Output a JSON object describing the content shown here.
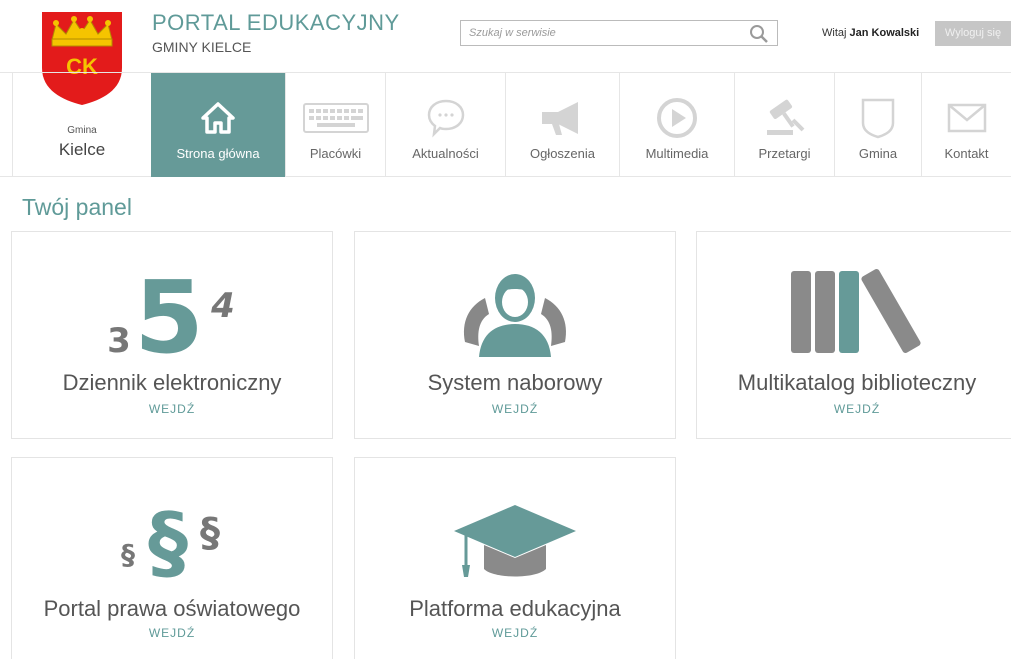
{
  "header": {
    "crest_text": "CK",
    "portal_title": "PORTAL EDUKACYJNY",
    "portal_subtitle": "GMINY KIELCE",
    "search_placeholder": "Szukaj w serwisie",
    "welcome_prefix": "Witaj",
    "user_name": "Jan Kowalski",
    "logout_label": "Wyloguj się"
  },
  "gmina": {
    "small": "Gmina",
    "big": "Kielce"
  },
  "nav": [
    {
      "label": "Strona główna",
      "icon": "home-icon",
      "active": true
    },
    {
      "label": "Placówki",
      "icon": "keyboard-icon"
    },
    {
      "label": "Aktualności",
      "icon": "speech-bubble-icon"
    },
    {
      "label": "Ogłoszenia",
      "icon": "megaphone-icon"
    },
    {
      "label": "Multimedia",
      "icon": "play-icon"
    },
    {
      "label": "Przetargi",
      "icon": "gavel-icon"
    },
    {
      "label": "Gmina",
      "icon": "shield-icon"
    },
    {
      "label": "Kontakt",
      "icon": "envelope-icon"
    }
  ],
  "panel": {
    "heading": "Twój panel",
    "tiles": [
      {
        "title": "Dziennik elektroniczny",
        "link": "WEJDŹ",
        "icon": "grades-icon",
        "glyphs": [
          "3",
          "5",
          "4"
        ]
      },
      {
        "title": "System naborowy",
        "link": "WEJDŹ",
        "icon": "person-icon"
      },
      {
        "title": "Multikatalog biblioteczny",
        "link": "WEJDŹ",
        "icon": "books-icon"
      },
      {
        "title": "Portal prawa oświatowego",
        "link": "WEJDŹ",
        "icon": "paragraph-icon",
        "glyphs": [
          "§",
          "§",
          "§"
        ]
      },
      {
        "title": "Platforma edukacyjna",
        "link": "WEJDŹ",
        "icon": "graduation-cap-icon"
      }
    ]
  },
  "colors": {
    "accent": "#669a98",
    "icon_gray": "#8a8a8a",
    "logout_bg": "#c6c6c6",
    "crest_red": "#e02020",
    "crest_gold": "#f2c200"
  }
}
